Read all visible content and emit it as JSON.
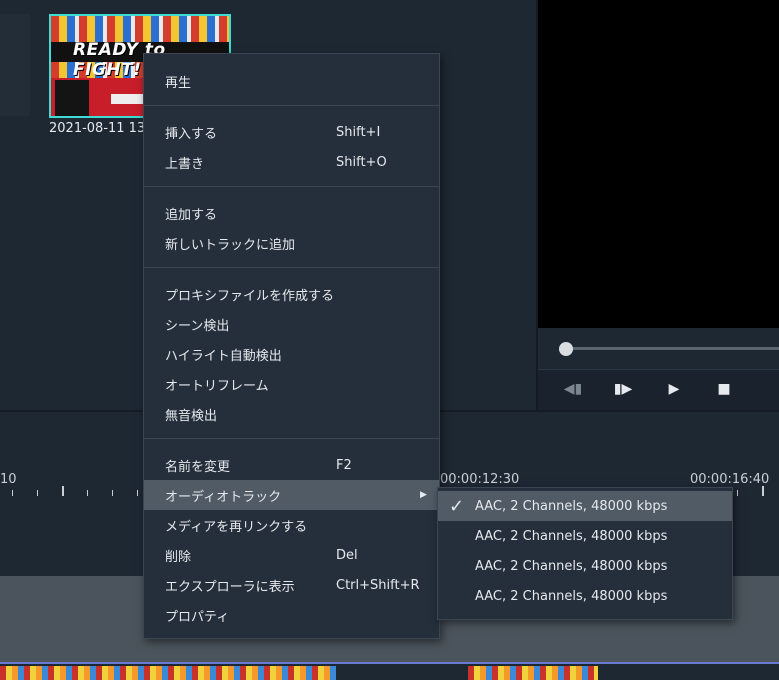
{
  "thumbnail": {
    "caption": "2021-08-11 13",
    "title_text": "READY to FIGHT!"
  },
  "ruler": {
    "labels": [
      "10",
      "00:00:12:30",
      "00:00:16:40"
    ]
  },
  "player": {
    "controls": [
      "prev-frame",
      "next-frame",
      "play",
      "stop"
    ]
  },
  "context_menu": {
    "play": "再生",
    "insert": "挿入する",
    "insert_sc": "Shift+I",
    "overwrite": "上書き",
    "overwrite_sc": "Shift+O",
    "add": "追加する",
    "add_new_track": "新しいトラックに追加",
    "create_proxy": "プロキシファイルを作成する",
    "scene_detect": "シーン検出",
    "highlight_detect": "ハイライト自動検出",
    "autoreframe": "オートリフレーム",
    "silence_detect": "無音検出",
    "rename": "名前を変更",
    "rename_sc": "F2",
    "audio_track": "オーディオトラック",
    "relink": "メディアを再リンクする",
    "delete": "削除",
    "delete_sc": "Del",
    "show_explorer": "エクスプローラに表示",
    "show_explorer_sc": "Ctrl+Shift+R",
    "properties": "プロパティ"
  },
  "audio_submenu": {
    "items": [
      "AAC, 2 Channels, 48000 kbps",
      "AAC, 2 Channels, 48000 kbps",
      "AAC, 2 Channels, 48000 kbps",
      "AAC, 2 Channels, 48000 kbps"
    ],
    "selected_index": 0
  },
  "colors": {
    "thumb_border": "#3ddbd3",
    "menu_bg": "#242f3b",
    "highlight": "#505b66"
  }
}
